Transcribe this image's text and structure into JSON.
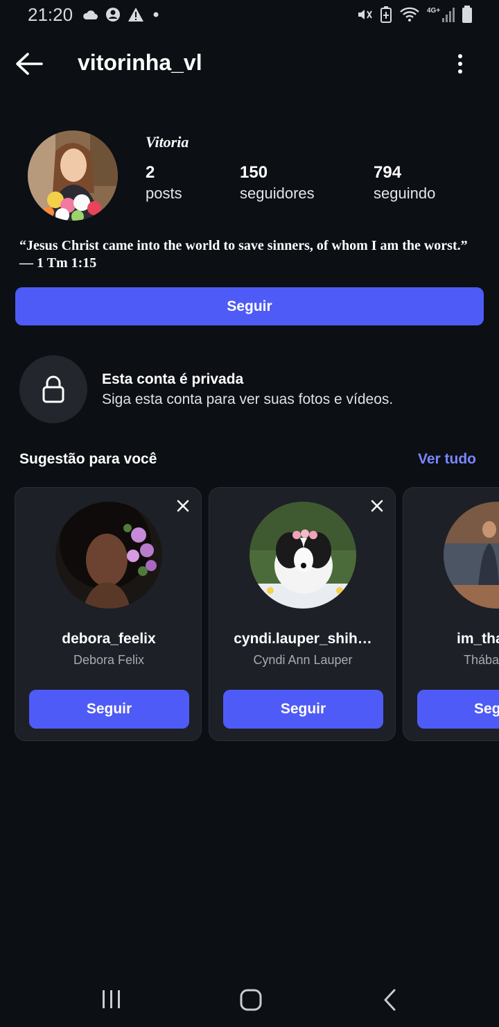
{
  "status_bar": {
    "time": "21:20",
    "icons_left": [
      "cloud-icon",
      "account-circle-icon",
      "warning-icon",
      "dot-icon"
    ],
    "icons_right": [
      "mute-vibrate-icon",
      "battery-saver-icon",
      "wifi-icon",
      "signal-4g-icon",
      "battery-icon"
    ]
  },
  "header": {
    "username": "vitorinha_vl"
  },
  "profile": {
    "display_name": "Vitoria",
    "stats": [
      {
        "value": "2",
        "label": "posts"
      },
      {
        "value": "150",
        "label": "seguidores"
      },
      {
        "value": "794",
        "label": "seguindo"
      }
    ],
    "bio": "“Jesus Christ came into the world to save sinners, of whom I am the worst.” — 1 Tm 1:15",
    "follow_label": "Seguir"
  },
  "private_notice": {
    "title": "Esta conta é privada",
    "subtitle": "Siga esta conta para ver suas fotos e vídeos."
  },
  "suggestions": {
    "title": "Sugestão para você",
    "see_all": "Ver tudo",
    "cards": [
      {
        "username": "debora_feelix",
        "name": "Debora Felix",
        "follow_label": "Seguir"
      },
      {
        "username": "cyndi.lauper_shih…",
        "name": "Cyndi Ann Lauper",
        "follow_label": "Seguir"
      },
      {
        "username": "im_tha",
        "name": "Thába",
        "follow_label": "Seg"
      }
    ]
  },
  "colors": {
    "background": "#0c0f14",
    "accent": "#4f5bf6",
    "link": "#7a86ff",
    "card": "#1d2026"
  }
}
